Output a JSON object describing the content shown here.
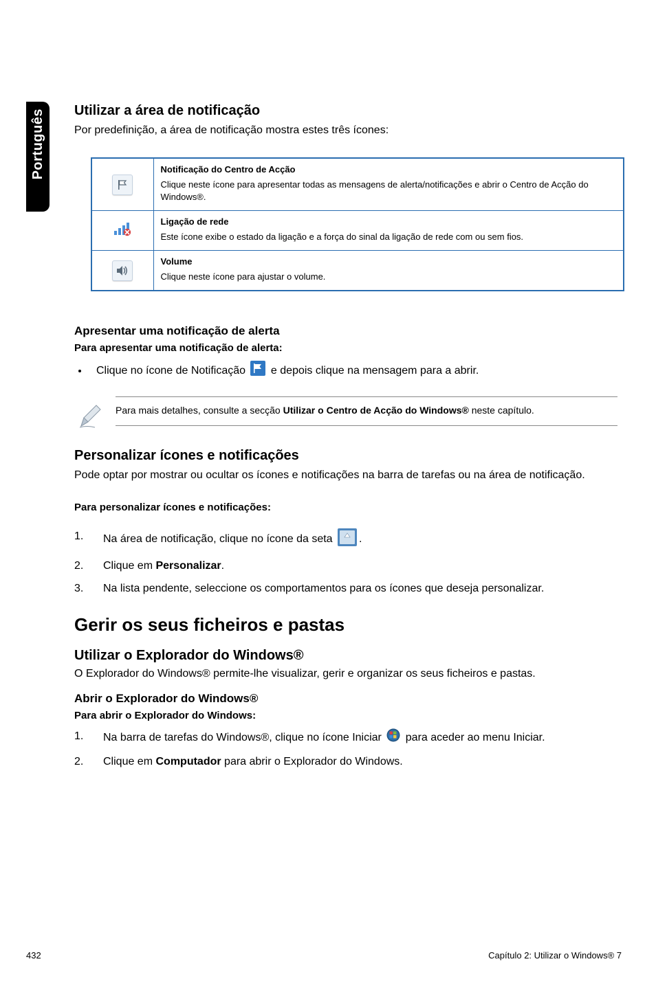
{
  "sideTab": "Português",
  "s1": {
    "heading": "Utilizar a área de notificação",
    "intro": "Por predefinição, a área de notificação mostra estes três ícones:",
    "rows": [
      {
        "iconName": "action-center-flag-icon",
        "title": "Notificação do Centro de Acção",
        "desc": "Clique neste ícone para apresentar todas as mensagens de alerta/notificações e abrir o Centro de Acção do Windows®."
      },
      {
        "iconName": "network-bars-icon",
        "title": "Ligação de rede",
        "desc": "Este ícone exibe o estado da ligação e a força do sinal da ligação de rede com ou sem fios."
      },
      {
        "iconName": "volume-speaker-icon",
        "title": "Volume",
        "desc": "Clique neste ícone para ajustar o volume."
      }
    ]
  },
  "s2": {
    "heading": "Apresentar uma notificação de alerta",
    "sub": "Para apresentar uma notificação de alerta:",
    "bullet_pre": "Clique no ícone de Notificação ",
    "bullet_post": " e depois clique na mensagem para a abrir."
  },
  "note1": {
    "pre": "Para mais detalhes, consulte a secção ",
    "bold": "Utilizar o Centro de Acção do Windows®",
    "post": " neste capítulo."
  },
  "s3": {
    "heading": "Personalizar ícones e notificações",
    "intro": "Pode optar por mostrar ou ocultar os ícones e notificações na barra de tarefas ou na área de notificação.",
    "sub": "Para personalizar ícones e notificações:",
    "steps": {
      "1_pre": "Na área de notificação, clique no ícone da seta ",
      "1_post": ".",
      "2_pre": "Clique em ",
      "2_bold": "Personalizar",
      "2_post": ".",
      "3": "Na lista pendente, seleccione os comportamentos para os ícones que deseja personalizar."
    }
  },
  "s4": {
    "bigHeading": "Gerir os seus ficheiros e pastas",
    "h1": "Utilizar o Explorador do Windows®",
    "intro": "O Explorador do Windows® permite-lhe visualizar, gerir e organizar os seus ficheiros e pastas.",
    "h2": "Abrir o Explorador do Windows®",
    "sub": "Para abrir o Explorador do Windows:",
    "steps": {
      "1_pre": "Na barra de tarefas do Windows®, clique no ícone Iniciar ",
      "1_post": " para aceder ao menu Iniciar.",
      "2_pre": "Clique em ",
      "2_bold": "Computador",
      "2_post": " para abrir o Explorador do Windows."
    }
  },
  "footer": {
    "left": "432",
    "right": "Capítulo 2: Utilizar o Windows® 7"
  }
}
